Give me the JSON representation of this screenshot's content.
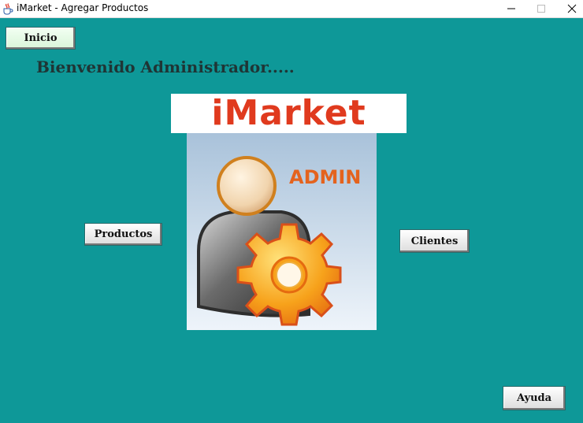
{
  "window": {
    "title": "iMarket - Agregar Productos",
    "icon": "java-cup-icon",
    "controls": [
      "minimize-icon",
      "maximize-icon",
      "close-icon"
    ]
  },
  "buttons": {
    "home": "Inicio",
    "products": "Productos",
    "clients": "Clientes",
    "help": "Ayuda"
  },
  "welcome": "Bienvenido Administrador.....",
  "brand": {
    "name": "iMarket",
    "color": "#e03a1e"
  },
  "admin_image": {
    "label": "ADMIN"
  },
  "colors": {
    "background": "#0e9898",
    "home_button": "#e6fbe6",
    "brand_red": "#e03a1e",
    "gear_orange": "#f7a21b"
  }
}
